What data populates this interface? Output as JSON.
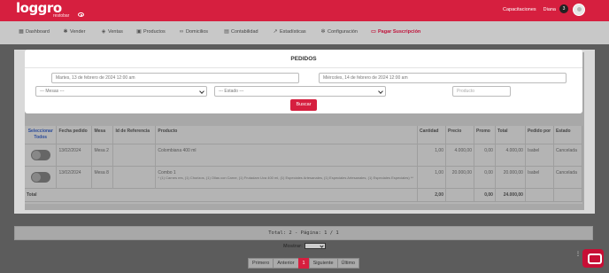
{
  "header": {
    "logo_text": "loggro",
    "logo_sub": "restobar",
    "links": [
      "Capacitaciones",
      "Diana"
    ],
    "badge": "3"
  },
  "nav": [
    {
      "label": "Dashboard",
      "icon": "dashboard-icon",
      "glyph": "▦"
    },
    {
      "label": "Vender",
      "icon": "cart-icon",
      "glyph": "✱"
    },
    {
      "label": "Ventas",
      "icon": "tag-icon",
      "glyph": "◈"
    },
    {
      "label": "Productos",
      "icon": "box-icon",
      "glyph": "▣"
    },
    {
      "label": "Domicilios",
      "icon": "bike-icon",
      "glyph": "∞"
    },
    {
      "label": "Contabilidad",
      "icon": "ledger-icon",
      "glyph": "▤"
    },
    {
      "label": "Estadísticas",
      "icon": "chart-icon",
      "glyph": "↗"
    },
    {
      "label": "Configuración",
      "icon": "gear-icon",
      "glyph": "✻"
    },
    {
      "label": "Pagar Suscripción",
      "icon": "card-icon",
      "glyph": "▭",
      "active": true
    }
  ],
  "modal": {
    "title": "PEDIDOS",
    "date_from": "Martes, 13 de febrero de 2024 12:00 am",
    "date_to": "Miércoles, 14 de febrero de 2024 12:00 am",
    "mesa_placeholder": "--- Mesas ---",
    "estado_placeholder": "--- Estado ---",
    "producto_placeholder": "Producto",
    "search_label": "Buscar"
  },
  "table": {
    "headers": [
      "Seleccionar Todos",
      "Fecha pedido",
      "Mesa",
      "Id de Referencia",
      "Producto",
      "Cantidad",
      "Precio",
      "Promo",
      "Total",
      "Pedido por",
      "Estado"
    ],
    "rows": [
      {
        "fecha": "13/02/2024",
        "mesa": "Mesa 2",
        "ref": "",
        "producto": "Colombiana 400 ml",
        "detalle": "",
        "cantidad": "1,00",
        "precio": "4.000,00",
        "promo": "0,00",
        "total": "4.000,00",
        "por": "Isabel",
        "estado": "Cancelada"
      },
      {
        "fecha": "13/02/2024",
        "mesa": "Mesa 8",
        "ref": "",
        "producto": "Combo 1",
        "detalle": "* (1) Carnes res, (1) Chorizos, (1) Ollas con Carne, (1) Frutadam Uva 400 ml, (1) Especiales Artesanales, (1) Especiales Artesanales, (1) Especiales Especiales) **",
        "cantidad": "1,00",
        "precio": "20.000,00",
        "promo": "0,00",
        "total": "20.000,00",
        "por": "Isabel",
        "estado": "Cancelada"
      }
    ],
    "total_label": "Total",
    "total_cantidad": "2,00",
    "total_promo": "0,00",
    "total_total": "24.000,00"
  },
  "pager": {
    "info": "Total: 2 - Página: 1 / 1",
    "mostrar": "Mostrar:",
    "pages": [
      "Primero",
      "Anterior",
      "1",
      "Siguiente",
      "Último"
    ],
    "active_page": "1"
  }
}
